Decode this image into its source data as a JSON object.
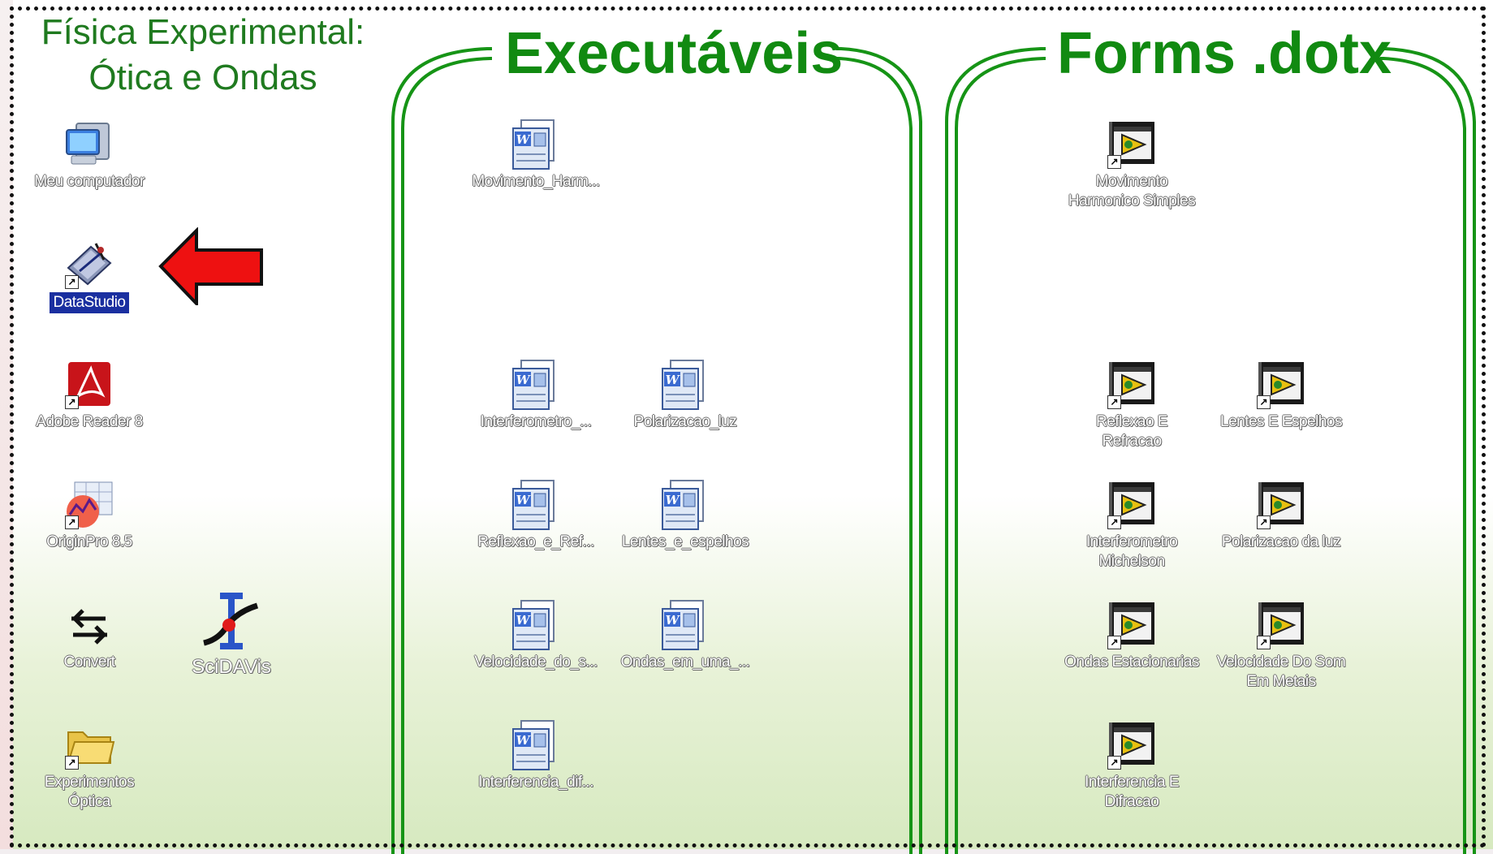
{
  "header": {
    "title_line1": "Física Experimental:",
    "title_line2": "Ótica e Ondas"
  },
  "panels": {
    "executaveis": "Executáveis",
    "forms": "Forms .dotx"
  },
  "desktop_icons": [
    {
      "label": "Meu computador",
      "icon": "computer-icon"
    },
    {
      "label": "DataStudio",
      "icon": "datastudio-icon",
      "selected": true
    },
    {
      "label": "Adobe Reader 8",
      "icon": "pdf-icon"
    },
    {
      "label": "OriginPro 8.5",
      "icon": "originpro-icon"
    },
    {
      "label": "Convert",
      "icon": "convert-arrows-icon"
    },
    {
      "label": "SciDAVis",
      "icon": "scidavis-icon"
    },
    {
      "label": "Experimentos Óptica",
      "icon": "folder-icon"
    }
  ],
  "executaveis_icons": [
    {
      "label": "Movimento_Harm..."
    },
    {
      "label": "Interferometro_..."
    },
    {
      "label": "Polarizacao_luz"
    },
    {
      "label": "Reflexao_e_Ref..."
    },
    {
      "label": "Lentes_e_espelhos"
    },
    {
      "label": "Velocidade_do_s..."
    },
    {
      "label": "Ondas_em_uma_..."
    },
    {
      "label": "Interferencia_dif..."
    }
  ],
  "forms_icons": [
    {
      "label_line1": "Movimento",
      "label_line2": "Harmonico Simples"
    },
    {
      "label_line1": "Reflexao E",
      "label_line2": "Refracao"
    },
    {
      "label_line1": "Lentes E Espelhos",
      "label_line2": ""
    },
    {
      "label_line1": "Interferometro",
      "label_line2": "Michelson"
    },
    {
      "label_line1": "Polarizacao da luz",
      "label_line2": ""
    },
    {
      "label_line1": "Ondas Estacionarias",
      "label_line2": ""
    },
    {
      "label_line1": "Velocidade Do Som",
      "label_line2": "Em Metais"
    },
    {
      "label_line1": "Interferencia E",
      "label_line2": "Difracao"
    }
  ],
  "colors": {
    "title_green": "#1f7a1f",
    "panel_green": "#118a11",
    "arrow_red": "#ee1111",
    "selection_blue": "#1a2fa0"
  }
}
